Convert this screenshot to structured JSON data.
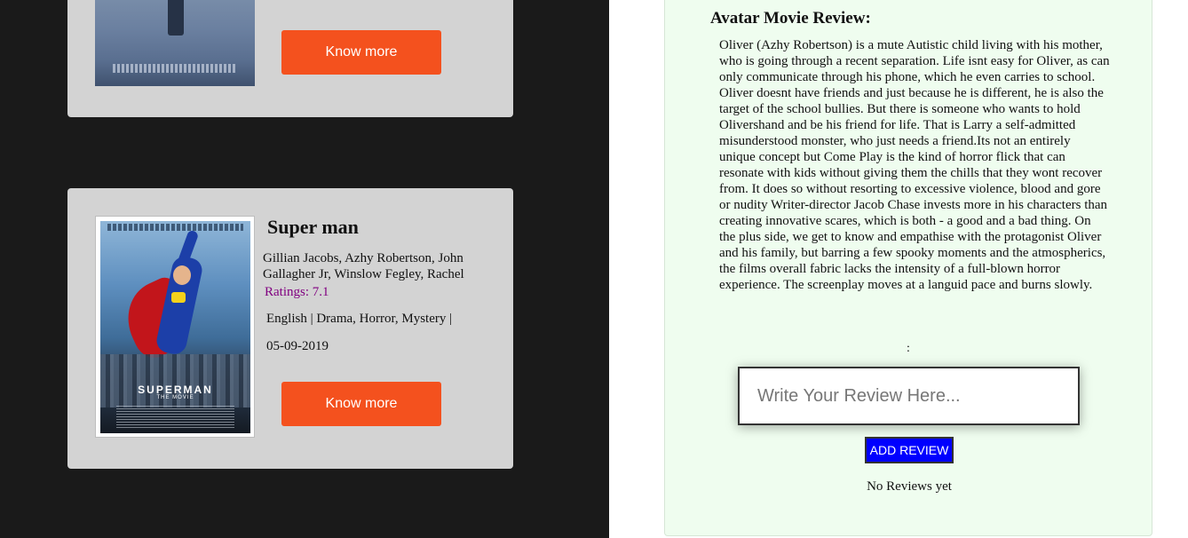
{
  "movies": [
    {
      "button_label": "Know more",
      "poster_icon": "movie-poster-image"
    },
    {
      "title": "Super man",
      "cast": "Gillian Jacobs, Azhy Robertson, John Gallagher Jr, Winslow Fegley, Rachel",
      "ratings": "Ratings: 7.1",
      "genres": "English | Drama, Horror, Mystery |",
      "release_date": "05-09-2019",
      "button_label": "Know more",
      "poster_text": "SUPERMAN",
      "poster_subtext": "THE MOVIE",
      "poster_icon": "superman-poster-image"
    }
  ],
  "review": {
    "heading": "Avatar Movie Review:",
    "body": "Oliver (Azhy Robertson) is a mute Autistic child living with his mother, who is going through a recent separation. Life isnt easy for Oliver, as can only communicate through his phone, which he even carries to school. Oliver doesnt have friends and just because he is different, he is also the target of the school bullies. But there is someone who wants to hold Olivershand and be his friend for life. That is Larry a self-admitted misunderstood monster, who just needs a friend.Its not an entirely unique concept but Come Play is the kind of horror flick that can resonate with kids without giving them the chills that they wont recover from. It does so without resorting to excessive violence, blood and gore or nudity Writer-director Jacob Chase invests more in his characters than creating innovative scares, which is both - a good and a bad thing. On the plus side, we get to know and empathise with the protagonist Oliver and his family, but barring a few spooky moments and the atmospherics, the films overall fabric lacks the intensity of a full-blown horror experience. The screenplay moves at a languid pace and burns slowly.",
    "separator": ":",
    "input_placeholder": "Write Your Review Here...",
    "input_value": "",
    "add_button_label": "ADD REVIEW",
    "empty_message": "No Reviews yet"
  },
  "colors": {
    "left_background": "#1a1a1a",
    "card_background": "#d3d3d3",
    "button_accent": "#f4511e",
    "rating_text": "#800080",
    "review_panel_background": "#effdef",
    "add_review_button": "#0000ff"
  }
}
